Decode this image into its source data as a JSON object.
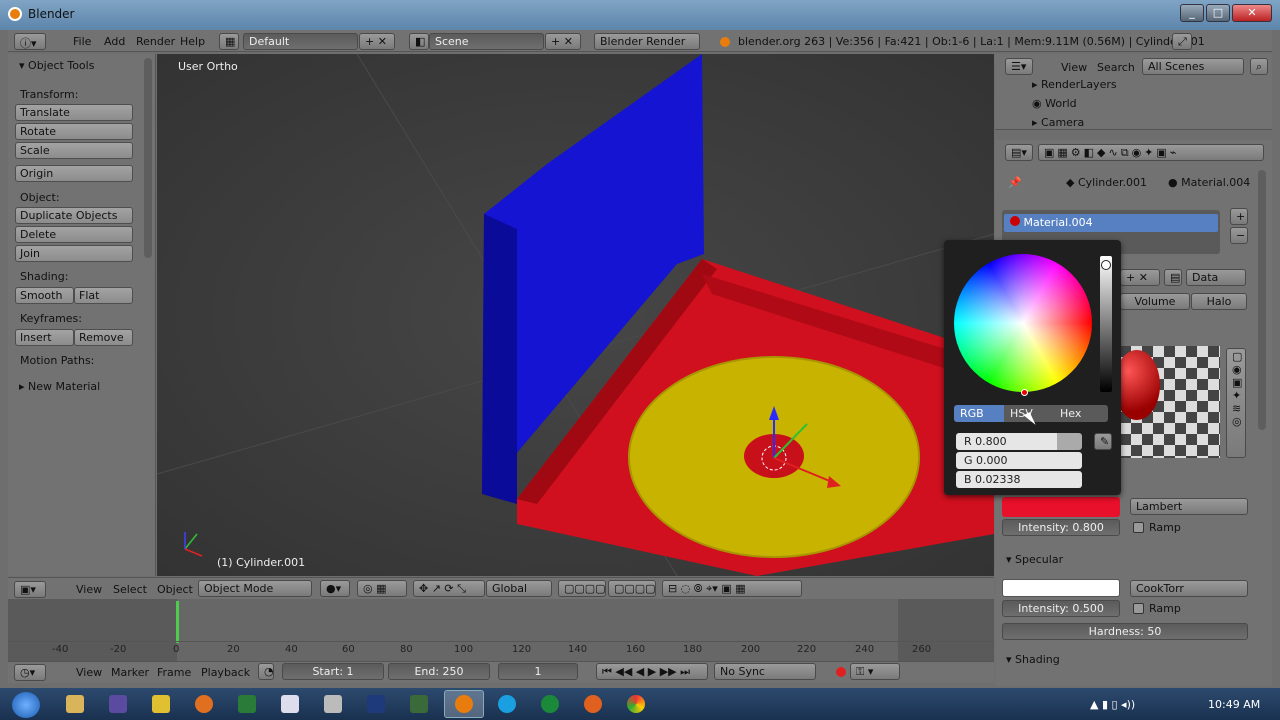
{
  "window": {
    "title": "Blender"
  },
  "info_header": {
    "menus": [
      "File",
      "Add",
      "Render",
      "Help"
    ],
    "layout": "Default",
    "scene": "Scene",
    "engine": "Blender Render",
    "stats": "blender.org 263 | Ve:356 | Fa:421 | Ob:1-6 | La:1 | Mem:9.11M (0.56M) | Cylinder.001"
  },
  "tools": {
    "title": "Object Tools",
    "transform_label": "Transform:",
    "translate": "Translate",
    "rotate": "Rotate",
    "scale": "Scale",
    "origin": "Origin",
    "object_label": "Object:",
    "duplicate": "Duplicate Objects",
    "delete": "Delete",
    "join": "Join",
    "shading_label": "Shading:",
    "smooth": "Smooth",
    "flat": "Flat",
    "keyframes_label": "Keyframes:",
    "insert": "Insert",
    "remove": "Remove",
    "motion_label": "Motion Paths:",
    "new_material": "New Material"
  },
  "viewport": {
    "view_label": "User Ortho",
    "object_label": "(1) Cylinder.001"
  },
  "view3d_header": {
    "menus": [
      "View",
      "Select",
      "Object"
    ],
    "mode": "Object Mode",
    "orientation": "Global"
  },
  "timeline": {
    "ticks": [
      "-40",
      "-20",
      "0",
      "20",
      "40",
      "60",
      "80",
      "100",
      "120",
      "140",
      "160",
      "180",
      "200",
      "220",
      "240",
      "260"
    ],
    "menus": [
      "View",
      "Marker",
      "Frame",
      "Playback"
    ],
    "start": "Start: 1",
    "end": "End: 250",
    "current": "1",
    "sync": "No Sync"
  },
  "outliner": {
    "view": "View",
    "search": "Search",
    "filter": "All Scenes",
    "items": [
      "RenderLayers",
      "World",
      "Camera"
    ]
  },
  "properties": {
    "breadcrumb_object": "Cylinder.001",
    "breadcrumb_material": "Material.004",
    "material_slot": "Material.004",
    "data_label": "Data",
    "tabs": [
      "Volume",
      "Halo"
    ],
    "diffuse_shader": "Lambert",
    "diffuse_intensity": "Intensity: 0.800",
    "ramp": "Ramp",
    "specular_title": "Specular",
    "specular_shader": "CookTorr",
    "specular_intensity": "Intensity: 0.500",
    "hardness": "Hardness: 50",
    "shading_title": "Shading",
    "diffuse_color": "#e8102a"
  },
  "color_picker": {
    "modes": [
      "RGB",
      "HSV",
      "Hex"
    ],
    "r": "R 0.800",
    "g": "G 0.000",
    "b": "B 0.02338"
  },
  "taskbar": {
    "time": "10:49 AM"
  }
}
